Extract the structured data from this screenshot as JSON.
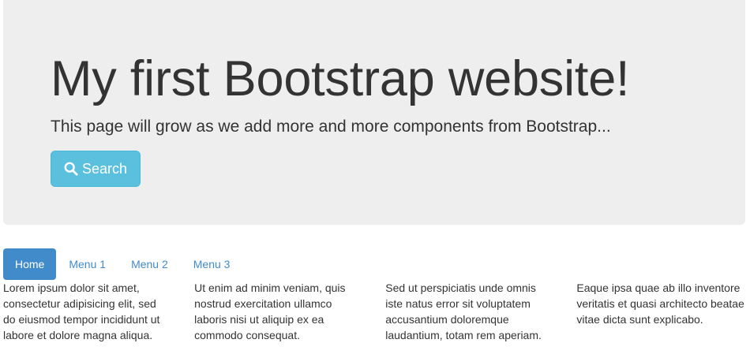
{
  "jumbotron": {
    "title": "My first Bootstrap website!",
    "lead": "This page will grow as we add more and more components from Bootstrap...",
    "search_button": {
      "icon": "search-icon",
      "label": "Search",
      "color": "#5bc0de"
    }
  },
  "nav": {
    "items": [
      {
        "label": "Home",
        "active": true
      },
      {
        "label": "Menu 1",
        "active": false
      },
      {
        "label": "Menu 2",
        "active": false
      },
      {
        "label": "Menu 3",
        "active": false
      }
    ],
    "accent_color": "#428bca"
  },
  "columns": [
    {
      "lines": [
        "Lorem ipsum dolor sit amet,",
        "consectetur adipisicing elit, sed",
        "do eiusmod tempor incididunt ut",
        "labore et dolore magna aliqua."
      ]
    },
    {
      "lines": [
        "Ut enim ad minim veniam, quis",
        "nostrud exercitation ullamco",
        "laboris nisi ut aliquip ex ea",
        "commodo consequat."
      ]
    },
    {
      "lines": [
        "Sed ut perspiciatis unde omnis",
        "iste natus error sit voluptatem",
        "accusantium doloremque",
        "laudantium, totam rem aperiam."
      ]
    },
    {
      "lines": [
        "Eaque ipsa quae ab illo inventore",
        "veritatis et quasi architecto beatae",
        "vitae dicta sunt explicabo."
      ]
    }
  ]
}
